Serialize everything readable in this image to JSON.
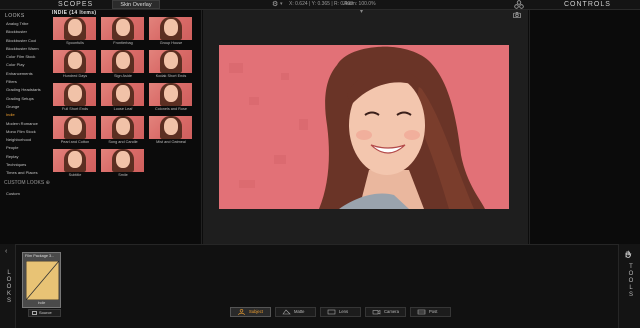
{
  "header": {
    "scopes_title": "SCOPES",
    "skin_overlay_label": "Skin Overlay",
    "coordinates": "X: 0.624 | Y: 0.365 | R: 0.408",
    "zoom": "Zoom: 100.0%",
    "controls_title": "CONTROLS"
  },
  "looks_panel": {
    "heading": "LOOKS",
    "categories": [
      "Analog Tribe",
      "Blockbuster",
      "Blockbuster Cool",
      "Blockbuster Warm",
      "Color Film Stock",
      "Color Play",
      "Enhancements",
      "Filters",
      "Grading Headstarts",
      "Grading Setups",
      "Grunge",
      "Indie",
      "Modern Romance",
      "Mono Film Stock",
      "Neighborhood",
      "People",
      "Replay",
      "Techniques",
      "Times and Places"
    ],
    "active_category": "Indie",
    "custom_heading": "CUSTOM LOOKS ⊕",
    "custom_items": [
      "Custom"
    ],
    "section_title": "INDIE (14 Items)",
    "thumbnails": [
      "Spoonfulls",
      "Frontierbag",
      "Group House",
      "Hundred Days",
      "Sign Aside",
      "Kodak Short Ends",
      "Full Short Ends",
      "Loose Leaf",
      "Colonels and Rose",
      "Pearl and Cotton",
      "Song and Candle",
      "Mist and Oatmeal",
      "Subtitle",
      "Smile"
    ]
  },
  "bottom": {
    "looks_vertical": "LOOKS",
    "tools_vertical": "TOOLS",
    "stack_name": "Film Package 3...",
    "stack_label": "Indie",
    "source_label": "Source",
    "tabs": [
      {
        "label": "Subject",
        "active": true
      },
      {
        "label": "Matte",
        "active": false
      },
      {
        "label": "Lens",
        "active": false
      },
      {
        "label": "Camera",
        "active": false
      },
      {
        "label": "Post",
        "active": false
      }
    ]
  },
  "colors": {
    "accent": "#f0a030",
    "photo_background": "#e06c74",
    "stack_swatch": "#e8c375"
  }
}
